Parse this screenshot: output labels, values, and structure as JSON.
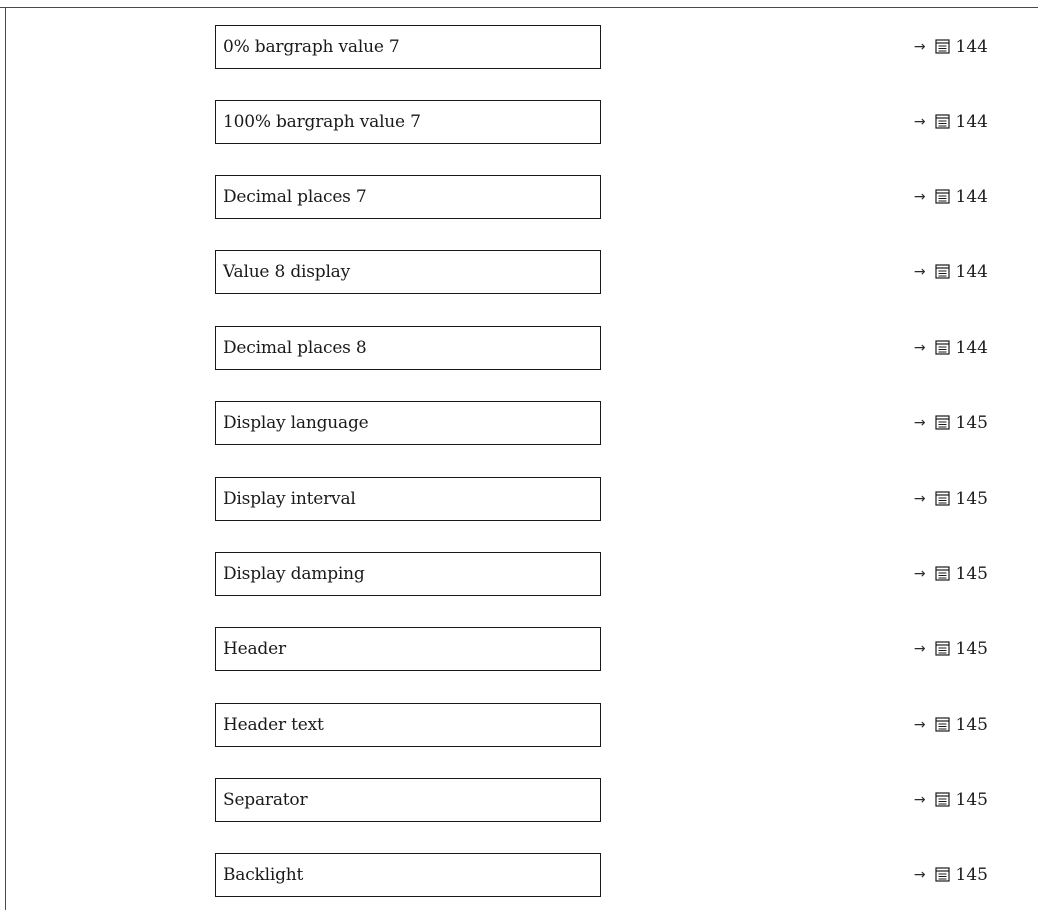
{
  "parameters": [
    {
      "label": "0% bargraph value 7",
      "page": "144"
    },
    {
      "label": "100% bargraph value 7",
      "page": "144"
    },
    {
      "label": "Decimal places 7",
      "page": "144"
    },
    {
      "label": "Value 8 display",
      "page": "144"
    },
    {
      "label": "Decimal places 8",
      "page": "144"
    },
    {
      "label": "Display language",
      "page": "145"
    },
    {
      "label": "Display interval",
      "page": "145"
    },
    {
      "label": "Display damping",
      "page": "145"
    },
    {
      "label": "Header",
      "page": "145"
    },
    {
      "label": "Header text",
      "page": "145"
    },
    {
      "label": "Separator",
      "page": "145"
    },
    {
      "label": "Backlight",
      "page": "145"
    }
  ],
  "icons": {
    "reference_arrow": "right-arrow-icon",
    "page_reference": "book-page-icon"
  }
}
